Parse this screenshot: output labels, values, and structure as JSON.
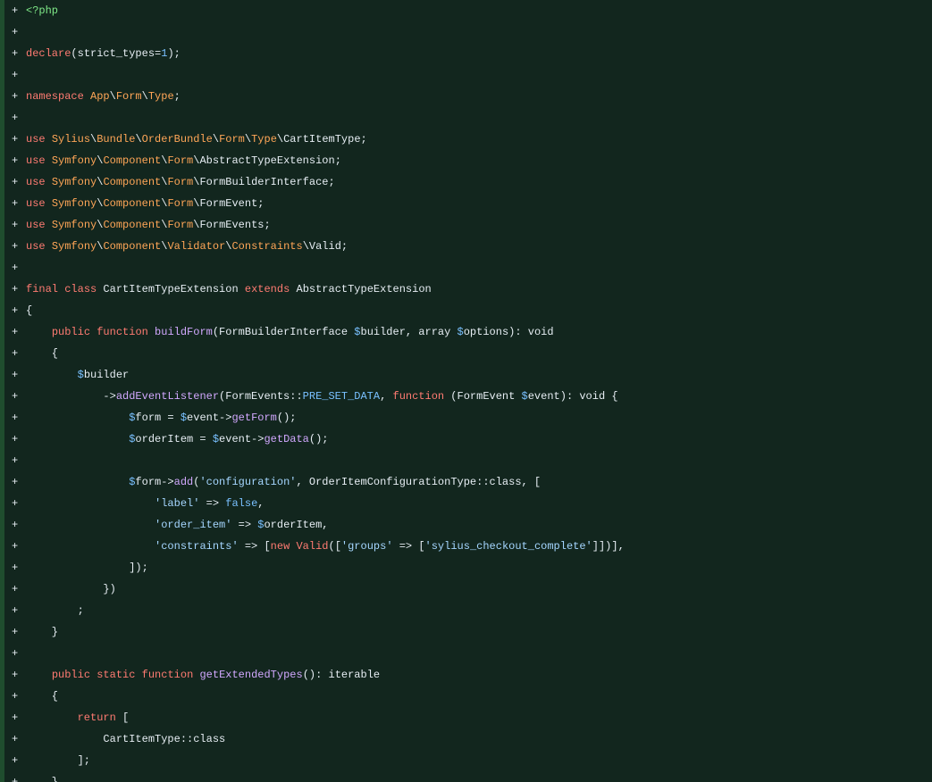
{
  "diff": {
    "marker": "+",
    "colors": {
      "background": "#12261e",
      "gutter": "#1f4d2e",
      "text": "#e6edf3",
      "keyword": "#ff7b72",
      "namespace": "#ffa657",
      "function": "#d2a8ff",
      "variable": "#79c0ff",
      "string": "#a5d6ff",
      "tag": "#7ee787"
    },
    "lines": [
      [
        [
          "t-tag",
          "<?php"
        ]
      ],
      [],
      [
        [
          "t-kw",
          "declare"
        ],
        [
          "t-txt",
          "(strict_types="
        ],
        [
          "t-num",
          "1"
        ],
        [
          "t-txt",
          ");"
        ]
      ],
      [],
      [
        [
          "t-kw",
          "namespace"
        ],
        [
          "t-txt",
          " "
        ],
        [
          "t-ns",
          "App"
        ],
        [
          "t-txt",
          "\\"
        ],
        [
          "t-ns",
          "Form"
        ],
        [
          "t-txt",
          "\\"
        ],
        [
          "t-ns",
          "Type"
        ],
        [
          "t-txt",
          ";"
        ]
      ],
      [],
      [
        [
          "t-kw",
          "use"
        ],
        [
          "t-txt",
          " "
        ],
        [
          "t-ns",
          "Sylius"
        ],
        [
          "t-txt",
          "\\"
        ],
        [
          "t-ns",
          "Bundle"
        ],
        [
          "t-txt",
          "\\"
        ],
        [
          "t-ns",
          "OrderBundle"
        ],
        [
          "t-txt",
          "\\"
        ],
        [
          "t-ns",
          "Form"
        ],
        [
          "t-txt",
          "\\"
        ],
        [
          "t-ns",
          "Type"
        ],
        [
          "t-txt",
          "\\CartItemType;"
        ]
      ],
      [
        [
          "t-kw",
          "use"
        ],
        [
          "t-txt",
          " "
        ],
        [
          "t-ns",
          "Symfony"
        ],
        [
          "t-txt",
          "\\"
        ],
        [
          "t-ns",
          "Component"
        ],
        [
          "t-txt",
          "\\"
        ],
        [
          "t-ns",
          "Form"
        ],
        [
          "t-txt",
          "\\AbstractTypeExtension;"
        ]
      ],
      [
        [
          "t-kw",
          "use"
        ],
        [
          "t-txt",
          " "
        ],
        [
          "t-ns",
          "Symfony"
        ],
        [
          "t-txt",
          "\\"
        ],
        [
          "t-ns",
          "Component"
        ],
        [
          "t-txt",
          "\\"
        ],
        [
          "t-ns",
          "Form"
        ],
        [
          "t-txt",
          "\\FormBuilderInterface;"
        ]
      ],
      [
        [
          "t-kw",
          "use"
        ],
        [
          "t-txt",
          " "
        ],
        [
          "t-ns",
          "Symfony"
        ],
        [
          "t-txt",
          "\\"
        ],
        [
          "t-ns",
          "Component"
        ],
        [
          "t-txt",
          "\\"
        ],
        [
          "t-ns",
          "Form"
        ],
        [
          "t-txt",
          "\\FormEvent;"
        ]
      ],
      [
        [
          "t-kw",
          "use"
        ],
        [
          "t-txt",
          " "
        ],
        [
          "t-ns",
          "Symfony"
        ],
        [
          "t-txt",
          "\\"
        ],
        [
          "t-ns",
          "Component"
        ],
        [
          "t-txt",
          "\\"
        ],
        [
          "t-ns",
          "Form"
        ],
        [
          "t-txt",
          "\\FormEvents;"
        ]
      ],
      [
        [
          "t-kw",
          "use"
        ],
        [
          "t-txt",
          " "
        ],
        [
          "t-ns",
          "Symfony"
        ],
        [
          "t-txt",
          "\\"
        ],
        [
          "t-ns",
          "Component"
        ],
        [
          "t-txt",
          "\\"
        ],
        [
          "t-ns",
          "Validator"
        ],
        [
          "t-txt",
          "\\"
        ],
        [
          "t-ns",
          "Constraints"
        ],
        [
          "t-txt",
          "\\Valid;"
        ]
      ],
      [],
      [
        [
          "t-kw",
          "final"
        ],
        [
          "t-txt",
          " "
        ],
        [
          "t-kw",
          "class"
        ],
        [
          "t-txt",
          " CartItemTypeExtension "
        ],
        [
          "t-kw",
          "extends"
        ],
        [
          "t-txt",
          " AbstractTypeExtension"
        ]
      ],
      [
        [
          "t-txt",
          "{"
        ]
      ],
      [
        [
          "t-txt",
          "    "
        ],
        [
          "t-kw",
          "public"
        ],
        [
          "t-txt",
          " "
        ],
        [
          "t-kw",
          "function"
        ],
        [
          "t-txt",
          " "
        ],
        [
          "t-fn",
          "buildForm"
        ],
        [
          "t-txt",
          "(FormBuilderInterface "
        ],
        [
          "t-var",
          "$"
        ],
        [
          "t-txt",
          "builder, array "
        ],
        [
          "t-var",
          "$"
        ],
        [
          "t-txt",
          "options): void"
        ]
      ],
      [
        [
          "t-txt",
          "    {"
        ]
      ],
      [
        [
          "t-txt",
          "        "
        ],
        [
          "t-var",
          "$"
        ],
        [
          "t-txt",
          "builder"
        ]
      ],
      [
        [
          "t-txt",
          "            ->"
        ],
        [
          "t-fn",
          "addEventListener"
        ],
        [
          "t-txt",
          "(FormEvents::"
        ],
        [
          "t-const",
          "PRE_SET_DATA"
        ],
        [
          "t-txt",
          ", "
        ],
        [
          "t-kw",
          "function"
        ],
        [
          "t-txt",
          " (FormEvent "
        ],
        [
          "t-var",
          "$"
        ],
        [
          "t-txt",
          "event): void {"
        ]
      ],
      [
        [
          "t-txt",
          "                "
        ],
        [
          "t-var",
          "$"
        ],
        [
          "t-txt",
          "form = "
        ],
        [
          "t-var",
          "$"
        ],
        [
          "t-txt",
          "event->"
        ],
        [
          "t-fn",
          "getForm"
        ],
        [
          "t-txt",
          "();"
        ]
      ],
      [
        [
          "t-txt",
          "                "
        ],
        [
          "t-var",
          "$"
        ],
        [
          "t-txt",
          "orderItem = "
        ],
        [
          "t-var",
          "$"
        ],
        [
          "t-txt",
          "event->"
        ],
        [
          "t-fn",
          "getData"
        ],
        [
          "t-txt",
          "();"
        ]
      ],
      [],
      [
        [
          "t-txt",
          "                "
        ],
        [
          "t-var",
          "$"
        ],
        [
          "t-txt",
          "form->"
        ],
        [
          "t-fn",
          "add"
        ],
        [
          "t-txt",
          "("
        ],
        [
          "t-str",
          "'configuration'"
        ],
        [
          "t-txt",
          ", OrderItemConfigurationType::class, ["
        ]
      ],
      [
        [
          "t-txt",
          "                    "
        ],
        [
          "t-str",
          "'label'"
        ],
        [
          "t-txt",
          " => "
        ],
        [
          "t-const",
          "false"
        ],
        [
          "t-txt",
          ","
        ]
      ],
      [
        [
          "t-txt",
          "                    "
        ],
        [
          "t-str",
          "'order_item'"
        ],
        [
          "t-txt",
          " => "
        ],
        [
          "t-var",
          "$"
        ],
        [
          "t-txt",
          "orderItem,"
        ]
      ],
      [
        [
          "t-txt",
          "                    "
        ],
        [
          "t-str",
          "'constraints'"
        ],
        [
          "t-txt",
          " => ["
        ],
        [
          "t-kw",
          "new"
        ],
        [
          "t-txt",
          " "
        ],
        [
          "t-cls",
          "Valid"
        ],
        [
          "t-txt",
          "(["
        ],
        [
          "t-str",
          "'groups'"
        ],
        [
          "t-txt",
          " => ["
        ],
        [
          "t-str",
          "'sylius_checkout_complete'"
        ],
        [
          "t-txt",
          "]])],"
        ]
      ],
      [
        [
          "t-txt",
          "                ]);"
        ]
      ],
      [
        [
          "t-txt",
          "            })"
        ]
      ],
      [
        [
          "t-txt",
          "        ;"
        ]
      ],
      [
        [
          "t-txt",
          "    }"
        ]
      ],
      [],
      [
        [
          "t-txt",
          "    "
        ],
        [
          "t-kw",
          "public"
        ],
        [
          "t-txt",
          " "
        ],
        [
          "t-kw",
          "static"
        ],
        [
          "t-txt",
          " "
        ],
        [
          "t-kw",
          "function"
        ],
        [
          "t-txt",
          " "
        ],
        [
          "t-fn",
          "getExtendedTypes"
        ],
        [
          "t-txt",
          "(): iterable"
        ]
      ],
      [
        [
          "t-txt",
          "    {"
        ]
      ],
      [
        [
          "t-txt",
          "        "
        ],
        [
          "t-kw",
          "return"
        ],
        [
          "t-txt",
          " ["
        ]
      ],
      [
        [
          "t-txt",
          "            CartItemType::class"
        ]
      ],
      [
        [
          "t-txt",
          "        ];"
        ]
      ],
      [
        [
          "t-txt",
          "    }"
        ]
      ]
    ]
  }
}
